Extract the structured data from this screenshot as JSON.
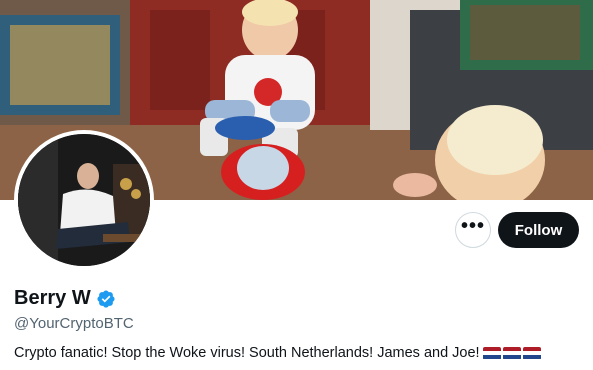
{
  "profile": {
    "display_name": "Berry W",
    "handle": "@YourCryptoBTC",
    "verified": true,
    "bio_text": "Crypto fanatic! Stop the Woke virus! South Netherlands! James and Joe!",
    "bio_emojis": [
      "netherlands-flag",
      "netherlands-flag",
      "netherlands-flag"
    ]
  },
  "actions": {
    "more_label": "•••",
    "follow_label": "Follow"
  },
  "colors": {
    "follow_bg": "#0f1419",
    "verified_blue": "#1d9bf0",
    "handle_gray": "#536471",
    "flag_red": "#ae1c28",
    "flag_white": "#ffffff",
    "flag_blue": "#21468b"
  }
}
